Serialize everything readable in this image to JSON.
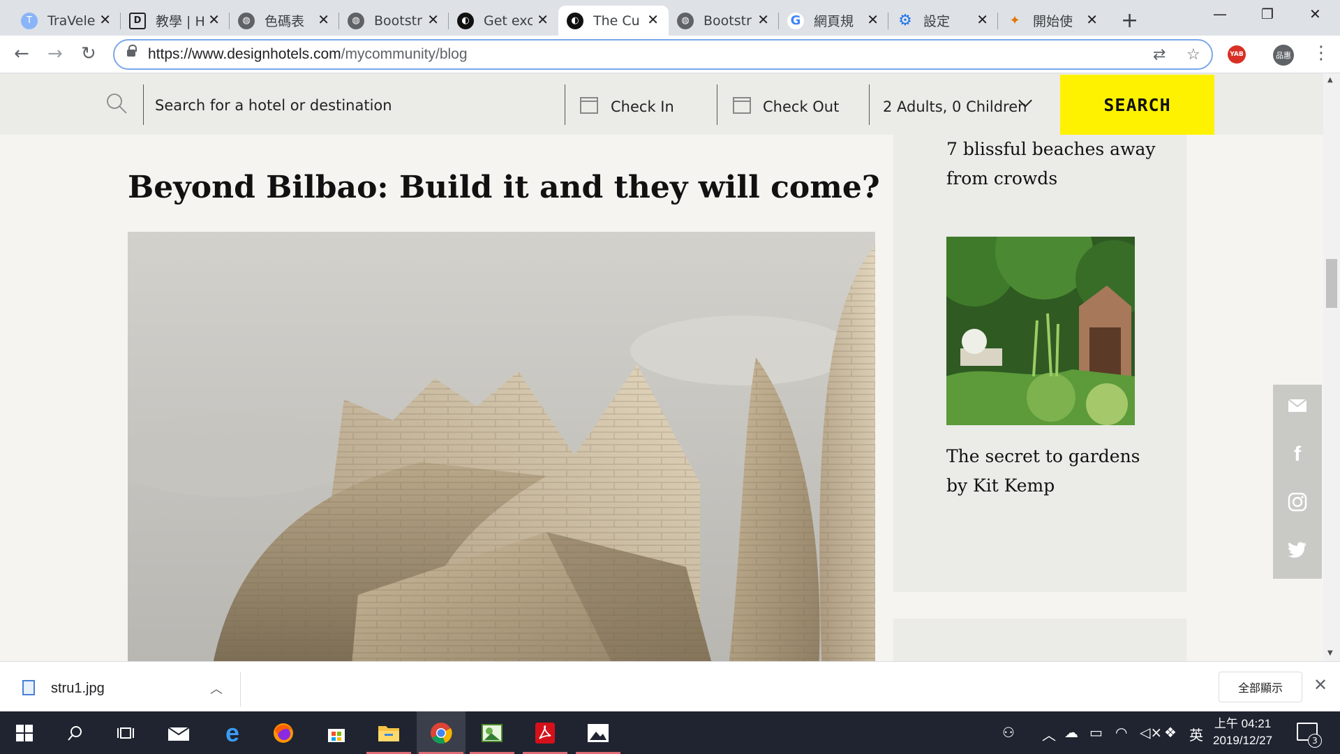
{
  "browser": {
    "tabs": [
      {
        "title": "TraVele",
        "icon": "travele-favicon-icon",
        "active": false
      },
      {
        "title": "教學 | H",
        "icon": "d-favicon-icon",
        "active": false
      },
      {
        "title": "色碼表",
        "icon": "globe-icon",
        "active": false
      },
      {
        "title": "Bootstr",
        "icon": "globe-icon",
        "active": false
      },
      {
        "title": "Get exc",
        "icon": "designhotels-favicon-icon",
        "active": false
      },
      {
        "title": "The Cu",
        "icon": "designhotels-favicon-icon",
        "active": true
      },
      {
        "title": "Bootstr",
        "icon": "globe-icon",
        "active": false
      },
      {
        "title": "網頁規",
        "icon": "google-favicon-icon",
        "active": false
      },
      {
        "title": "設定",
        "icon": "settings-gear-icon",
        "active": false
      },
      {
        "title": "開始使",
        "icon": "party-popper-icon",
        "active": false
      }
    ],
    "url_host": "https://www.designhotels.com",
    "url_path": "/mycommunity/blog",
    "ext_label": "YAB",
    "profile_label": "品惠"
  },
  "sitebar": {
    "search_placeholder": "Search for a hotel or destination",
    "check_in": "Check In",
    "check_out": "Check Out",
    "guests": "2 Adults, 0 Children",
    "search_button": "SEARCH",
    "button_color": "#fff200"
  },
  "article": {
    "title": "Beyond Bilbao: Build it and they will come?"
  },
  "sidebar": {
    "card1_text": "7 blissful beaches away from crowds",
    "card2_text": "The secret to gardens by Kit Kemp"
  },
  "share": [
    "mail-icon",
    "facebook-icon",
    "instagram-icon",
    "twitter-icon"
  ],
  "download": {
    "filename": "stru1.jpg",
    "show_all": "全部顯示"
  },
  "taskbar": {
    "time": "上午 04:21",
    "date": "2019/12/27",
    "ime": "英",
    "notifications": "3"
  }
}
